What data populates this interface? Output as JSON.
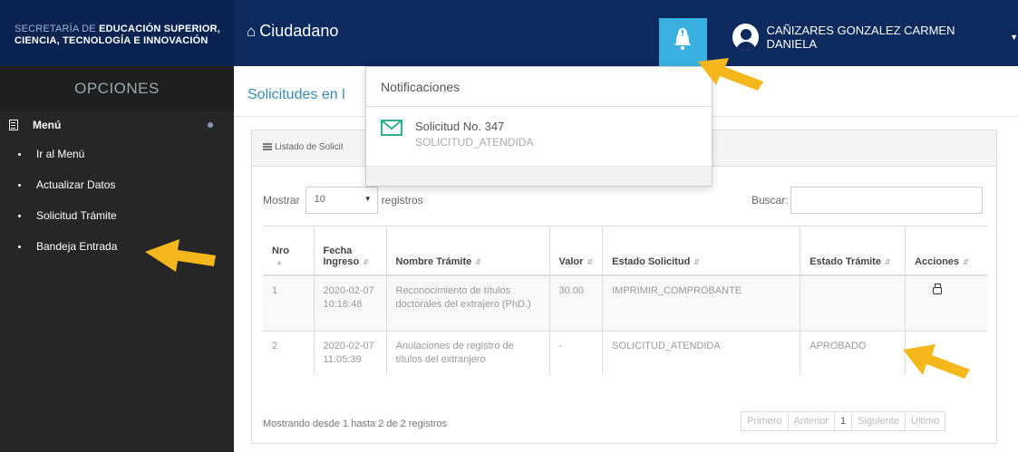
{
  "header": {
    "brand_light": "SECRETARÍA DE",
    "brand_bold_1": "EDUCACIÓN SUPERIOR,",
    "brand_bold_2": "CIENCIA, TECNOLOGÍA E INNOVACIÓN",
    "app_title": "Ciudadano",
    "user_name": "CAÑIZARES GONZALEZ CARMEN DANIELA"
  },
  "sidebar": {
    "title": "OPCIONES",
    "menu_label": "Menú",
    "items": [
      "Ir al Menú",
      "Actualizar Datos",
      "Solicitud Trámite",
      "Bandeja Entrada"
    ]
  },
  "main": {
    "page_title": "Solicitudes en l",
    "panel_title": "Listado de Solicit",
    "show_label": "Mostrar",
    "show_value": "10",
    "records_label": "registros",
    "search_label": "Buscar:",
    "search_value": "",
    "columns": [
      "Nro",
      "Fecha Ingreso",
      "Nombre Trámite",
      "Valor",
      "Estado Solicitud",
      "Estado Trámite",
      "Acciones"
    ],
    "rows": [
      {
        "nro": "1",
        "fecha": "2020-02-07 10:16:48",
        "nombre": "Reconocimiento de títulos doctorales del extrajero (PhD.)",
        "valor": "30.00",
        "estado_sol": "IMPRIMIR_COMPROBANTE",
        "estado_tram": ""
      },
      {
        "nro": "2",
        "fecha": "2020-02-07 11:05:39",
        "nombre": "Anulaciones de registro de títulos del extranjero",
        "valor": "-",
        "estado_sol": "SOLICITUD_ATENDIDA",
        "estado_tram": "APROBADO"
      }
    ],
    "info": "Mostrando desde 1 hasta 2 de 2 registros",
    "pager": [
      "Primero",
      "Anterior",
      "1",
      "Siguiente",
      "Último"
    ]
  },
  "notifications": {
    "title": "Notificaciones",
    "item_title": "Solicitud No. 347",
    "item_status": "SOLICITUD_ATENDIDA"
  },
  "colors": {
    "topbar": "#0c2a5e",
    "bell_active": "#3ab0e0",
    "arrow": "#f5b81c",
    "envelope": "#2fb08c"
  }
}
